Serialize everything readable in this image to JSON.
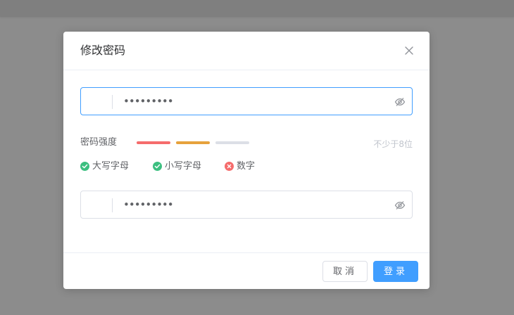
{
  "dialog": {
    "title": "修改密码"
  },
  "password": {
    "value": "•••••••••",
    "focused": true
  },
  "strength": {
    "label": "密码强度",
    "bars": [
      "#f56c6c",
      "#e6a23c",
      "#dcdfe6"
    ],
    "hint": "不少于8位"
  },
  "rules": [
    {
      "label": "大写字母",
      "passed": true
    },
    {
      "label": "小写字母",
      "passed": true
    },
    {
      "label": "数字",
      "passed": false
    }
  ],
  "confirm_password": {
    "value": "•••••••••"
  },
  "footer": {
    "cancel_label": "取消",
    "confirm_label": "登录"
  },
  "colors": {
    "primary": "#409eff",
    "success": "#3cbf80",
    "danger": "#f56c6c"
  }
}
